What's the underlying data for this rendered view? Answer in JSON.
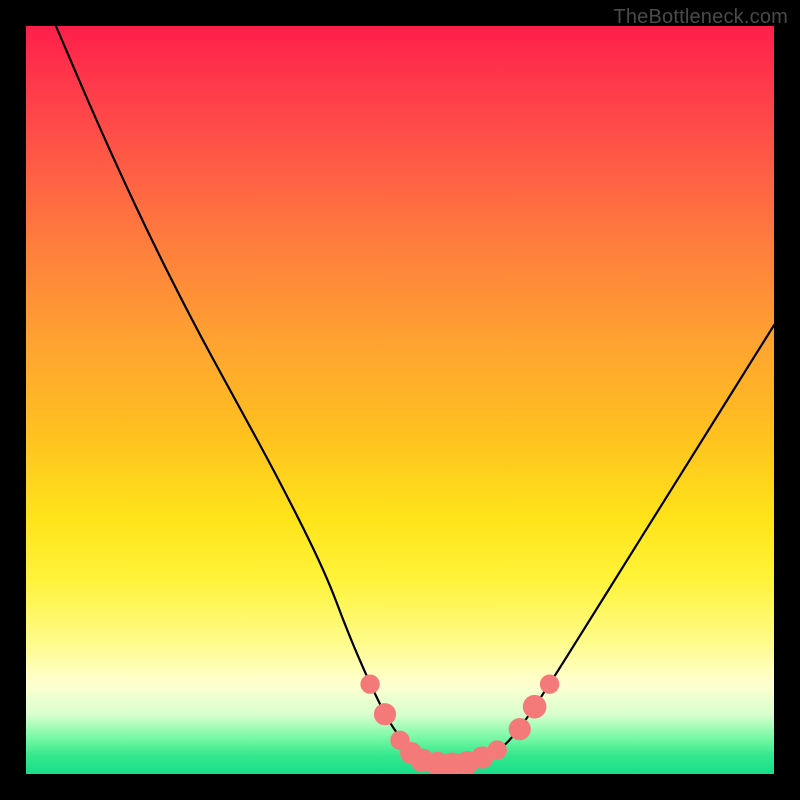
{
  "watermark": "TheBottleneck.com",
  "chart_data": {
    "type": "line",
    "title": "",
    "xlabel": "",
    "ylabel": "",
    "xlim": [
      0,
      100
    ],
    "ylim": [
      0,
      100
    ],
    "series": [
      {
        "name": "bottleneck-curve",
        "x": [
          4,
          10,
          16,
          22,
          28,
          34,
          40,
          43,
          46,
          49,
          52,
          54,
          56,
          58,
          60,
          63,
          66,
          70,
          75,
          80,
          85,
          90,
          95,
          100
        ],
        "values": [
          100,
          86,
          73,
          61,
          50,
          39,
          27,
          19,
          12,
          6,
          2.8,
          1.8,
          1.3,
          1.3,
          1.6,
          2.8,
          6,
          12,
          20,
          28,
          36,
          44,
          52,
          60
        ]
      }
    ],
    "markers": [
      {
        "x": 46,
        "y": 12,
        "r": 1.0
      },
      {
        "x": 48,
        "y": 8,
        "r": 1.2
      },
      {
        "x": 50,
        "y": 4.5,
        "r": 1.0
      },
      {
        "x": 51.5,
        "y": 2.8,
        "r": 1.2
      },
      {
        "x": 53,
        "y": 1.8,
        "r": 1.3
      },
      {
        "x": 55,
        "y": 1.4,
        "r": 1.3
      },
      {
        "x": 57,
        "y": 1.3,
        "r": 1.3
      },
      {
        "x": 59,
        "y": 1.5,
        "r": 1.3
      },
      {
        "x": 61,
        "y": 2.2,
        "r": 1.2
      },
      {
        "x": 63,
        "y": 3.2,
        "r": 1.0
      },
      {
        "x": 66,
        "y": 6,
        "r": 1.2
      },
      {
        "x": 68,
        "y": 9,
        "r": 1.3
      },
      {
        "x": 70,
        "y": 12,
        "r": 1.0
      }
    ],
    "colors": {
      "curve": "#000000",
      "marker": "#f47a7a"
    }
  }
}
